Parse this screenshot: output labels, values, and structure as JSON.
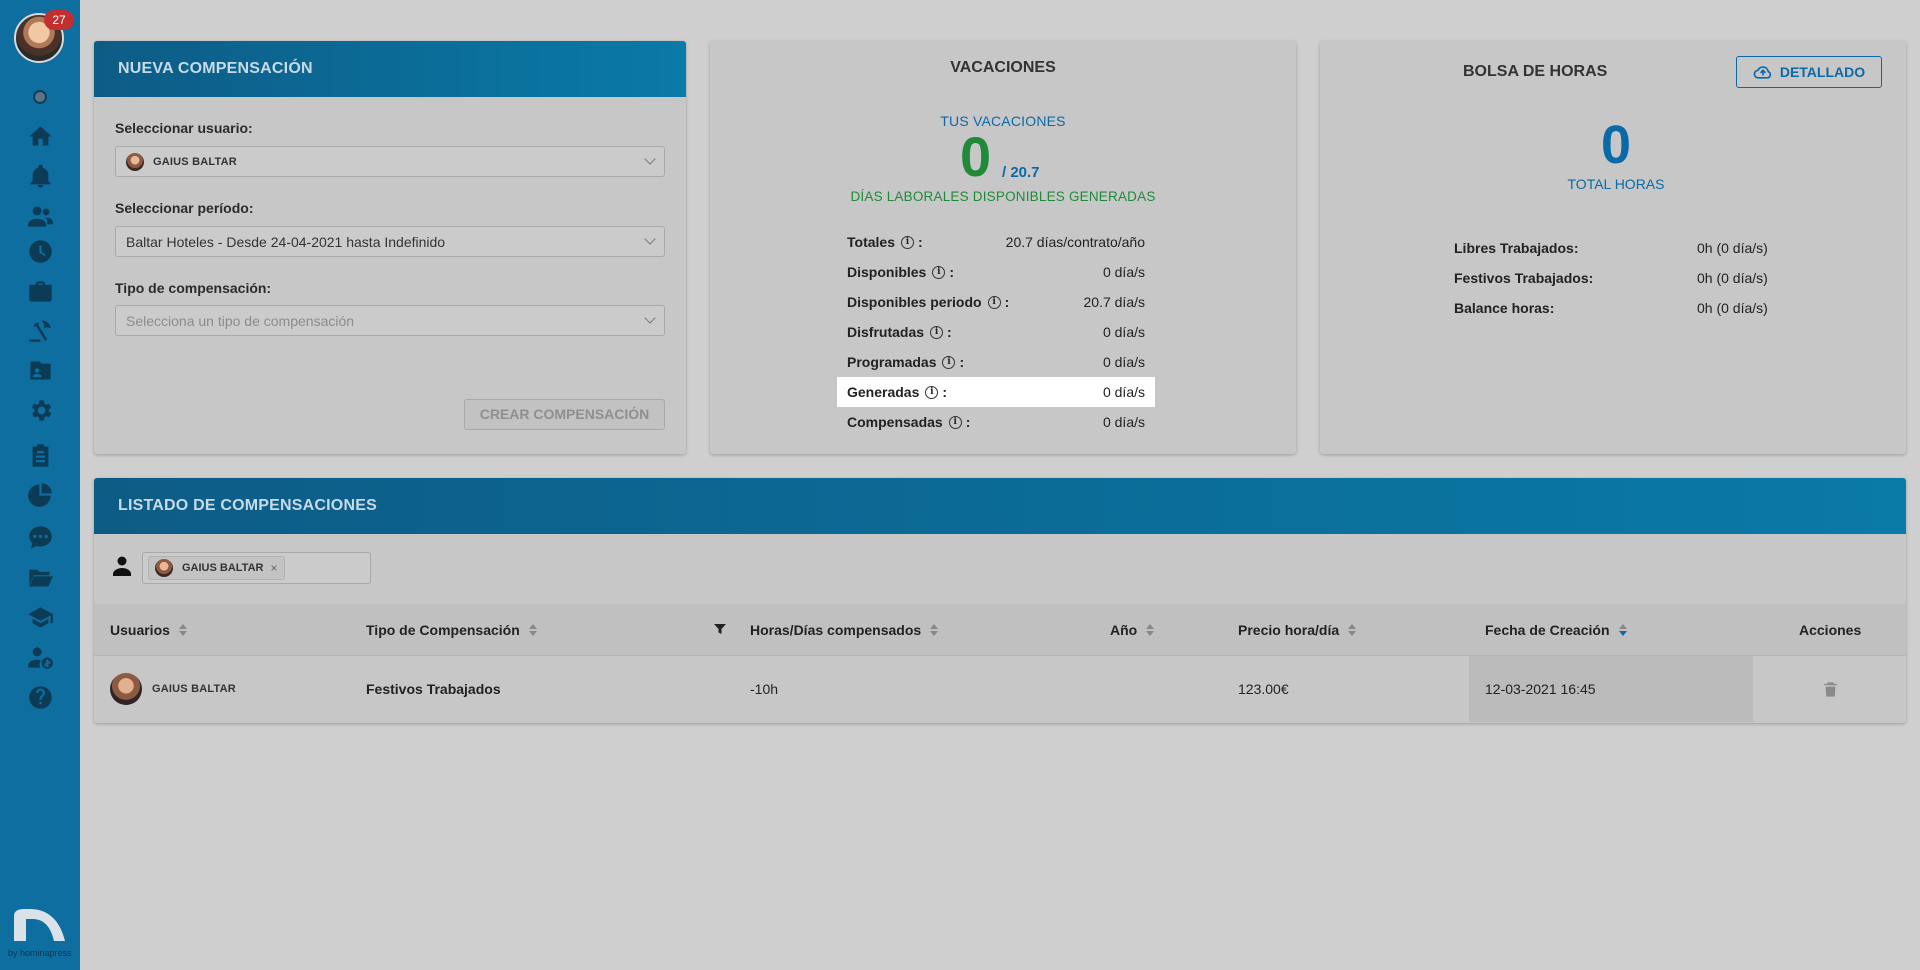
{
  "sidebar": {
    "notifications_count": "27",
    "brand_text": "by hominapress",
    "nav_items": [
      "home-icon",
      "bell-icon",
      "users-icon",
      "clock-icon",
      "briefcase-icon",
      "holiday-icon",
      "id-card-icon",
      "gear-icon",
      "clipboard-icon",
      "pie-chart-icon",
      "chat-icon",
      "folder-icon",
      "graduation-cap-icon",
      "user-money-icon",
      "help-icon"
    ]
  },
  "new_compensation": {
    "title": "NUEVA COMPENSACIÓN",
    "user_label": "Seleccionar usuario:",
    "user_value": "GAIUS BALTAR",
    "period_label": "Seleccionar período:",
    "period_value": "Baltar Hoteles - Desde 24-04-2021 hasta Indefinido",
    "type_label": "Tipo de compensación:",
    "type_placeholder": "Selecciona un tipo de compensación",
    "create_button": "CREAR COMPENSACIÓN"
  },
  "vacaciones": {
    "title": "VACACIONES",
    "subtitle": "TUS VACACIONES",
    "available": "0",
    "total": "/ 20.7",
    "caption": "DÍAS LABORALES DISPONIBLES GENERADAS",
    "rows": [
      {
        "label": "Totales",
        "value": "20.7 días/contrato/año"
      },
      {
        "label": "Disponibles",
        "value": "0 día/s"
      },
      {
        "label": "Disponibles periodo",
        "value": "20.7 día/s"
      },
      {
        "label": "Disfrutadas",
        "value": "0 día/s"
      },
      {
        "label": "Programadas",
        "value": "0 día/s"
      },
      {
        "label": "Generadas",
        "value": "0 día/s"
      },
      {
        "label": "Compensadas",
        "value": "0 día/s"
      }
    ]
  },
  "bolsa": {
    "title": "BOLSA DE HORAS",
    "detail_button": "DETALLADO",
    "total": "0",
    "total_caption": "TOTAL HORAS",
    "rows": [
      {
        "label": "Libres Trabajados:",
        "value": "0h (0 día/s)"
      },
      {
        "label": "Festivos Trabajados:",
        "value": "0h (0 día/s)"
      },
      {
        "label": "Balance horas:",
        "value": "0h (0 día/s)"
      }
    ]
  },
  "listado": {
    "title": "LISTADO DE COMPENSACIONES",
    "filter_chip": "GAIUS BALTAR",
    "chip_remove": "×",
    "columns": [
      "Usuarios",
      "Tipo de Compensación",
      "Horas/Días compensados",
      "Año",
      "Precio hora/día",
      "Fecha de Creación",
      "Acciones"
    ],
    "rows": [
      {
        "user": "GAIUS BALTAR",
        "type": "Festivos Trabajados",
        "hours": "-10h",
        "year": "",
        "price": "123.00€",
        "created": "12-03-2021 16:45"
      }
    ]
  },
  "colors": {
    "sidebar": "#0e6ea0",
    "accent_blue": "#0a6aa7",
    "accent_green": "#1f8a3a",
    "badge_red": "#c12f2f"
  }
}
